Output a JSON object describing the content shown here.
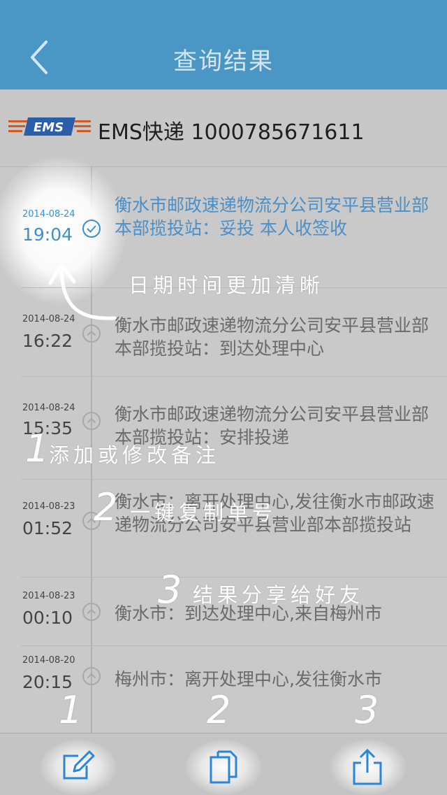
{
  "nav": {
    "title": "查询结果"
  },
  "tracking": {
    "carrier_logo_text": "EMS",
    "label": "EMS快递 1000785671611"
  },
  "events": [
    {
      "date": "2014-08-24",
      "time": "19:04",
      "text": "衡水市邮政速递物流分公司安平县营业部本部揽投站：妥投 本人收签收",
      "current": true
    },
    {
      "date": "2014-08-24",
      "time": "16:22",
      "text": "衡水市邮政速递物流分公司安平县营业部本部揽投站：到达处理中心"
    },
    {
      "date": "2014-08-24",
      "time": "15:35",
      "text": "衡水市邮政速递物流分公司安平县营业部本部揽投站：安排投递"
    },
    {
      "date": "2014-08-23",
      "time": "01:52",
      "text": "衡水市：离开处理中心,发往衡水市邮政速递物流分公司安平县营业部本部揽投站"
    },
    {
      "date": "2014-08-23",
      "time": "00:10",
      "text": "衡水市：到达处理中心,来自梅州市"
    },
    {
      "date": "2014-08-20",
      "time": "20:15",
      "text": "梅州市：离开处理中心,发往衡水市"
    }
  ],
  "annotations": {
    "clear_time": "日期时间更加清晰",
    "note": {
      "num": "1",
      "text": "添加或修改备注"
    },
    "copy": {
      "num": "2",
      "text": "一键复制单号"
    },
    "share": {
      "num": "3",
      "text": "结果分享给好友"
    },
    "tab_nums": [
      "1",
      "2",
      "3"
    ]
  },
  "tabbar": {
    "items": [
      {
        "icon": "edit-note-icon"
      },
      {
        "icon": "copy-icon"
      },
      {
        "icon": "share-icon"
      }
    ]
  },
  "colors": {
    "nav_bg": "#4a96c4",
    "accent": "#3a8fd8",
    "overlay_bg": "#c9c9c9"
  }
}
